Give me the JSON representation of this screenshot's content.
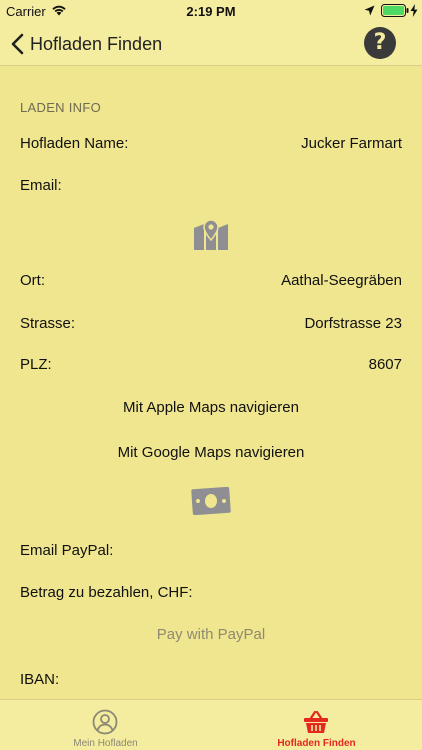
{
  "status_bar": {
    "carrier": "Carrier",
    "time": "2:19 PM",
    "icons": [
      "wifi-icon",
      "location-icon",
      "battery-icon",
      "charge-icon"
    ]
  },
  "nav": {
    "back_label": "Hofladen Finden",
    "help_label": "?"
  },
  "section": {
    "header": "LADEN INFO"
  },
  "fields": {
    "name": {
      "label": "Hofladen Name:",
      "value": "Jucker Farmart"
    },
    "email": {
      "label": "Email:",
      "value": ""
    },
    "ort": {
      "label": "Ort:",
      "value": "Aathal-Seegräben"
    },
    "strasse": {
      "label": "Strasse:",
      "value": "Dorfstrasse 23"
    },
    "plz": {
      "label": "PLZ:",
      "value": "8607"
    },
    "email_paypal": {
      "label": "Email PayPal:",
      "value": ""
    },
    "betrag": {
      "label": "Betrag zu bezahlen, CHF:",
      "value": ""
    },
    "iban": {
      "label": "IBAN:",
      "value": ""
    }
  },
  "actions": {
    "apple_maps": "Mit Apple Maps navigieren",
    "google_maps": "Mit Google Maps navigieren",
    "paypal": "Pay with PayPal"
  },
  "tabs": [
    {
      "label": "Mein Hofladen",
      "icon": "person-circle-icon",
      "active": false
    },
    {
      "label": "Hofladen Finden",
      "icon": "basket-icon",
      "active": true
    }
  ],
  "colors": {
    "background": "#f0e68f",
    "bar_background": "#f4ec9e",
    "active_tab": "#e3281e",
    "inactive_tab": "#8c8874",
    "icon_gray": "#8e8e93"
  }
}
